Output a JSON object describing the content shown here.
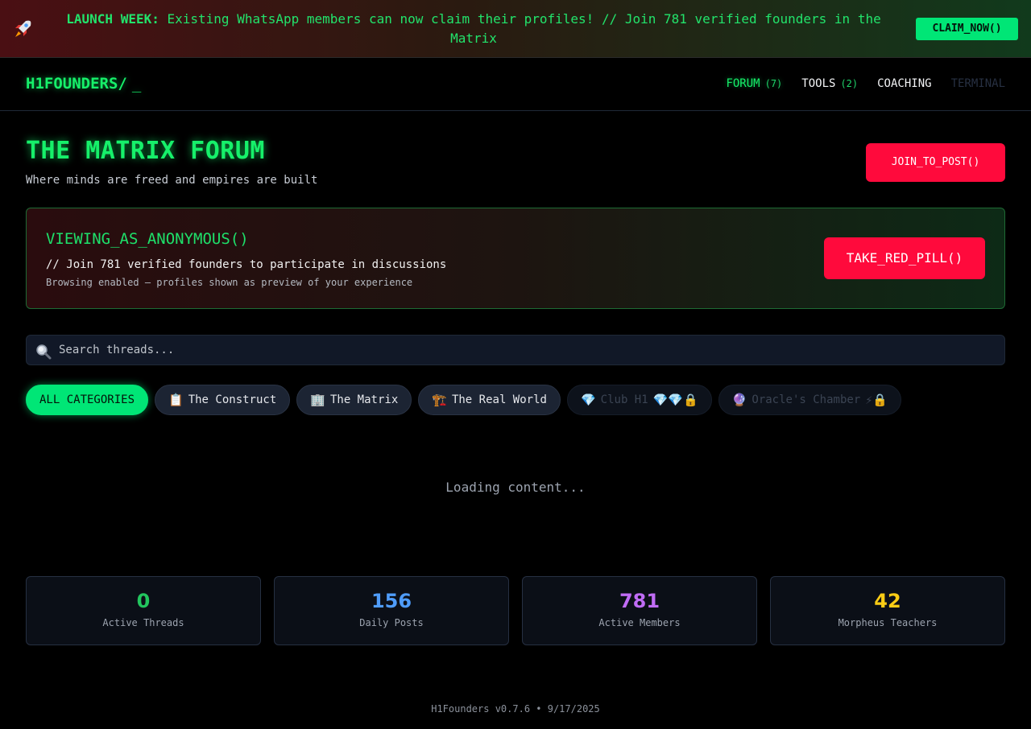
{
  "banner": {
    "icon": "rocket-icon",
    "label": "LAUNCH WEEK:",
    "message": "Existing WhatsApp members can now claim their profiles! // Join 781 verified founders in the Matrix",
    "cta": "CLAIM_NOW()"
  },
  "nav": {
    "logo": "H1FOUNDERS/",
    "cursor": "_",
    "items": [
      {
        "label": "FORUM",
        "count": "(7)",
        "state": "active"
      },
      {
        "label": "TOOLS",
        "count": "(2)",
        "state": "normal"
      },
      {
        "label": "COACHING",
        "count": "",
        "state": "normal"
      },
      {
        "label": "TERMINAL",
        "count": "",
        "state": "disabled"
      }
    ]
  },
  "hero": {
    "title": "THE MATRIX FORUM",
    "subtitle": "Where minds are freed and empires are built",
    "join_button": "JOIN_TO_POST()"
  },
  "anon_panel": {
    "heading": "VIEWING_AS_ANONYMOUS()",
    "line1": "// Join 781 verified founders to participate in discussions",
    "line2": "Browsing enabled — profiles shown as preview of your experience",
    "button": "TAKE_RED_PILL()"
  },
  "search": {
    "icon": "search-icon",
    "placeholder": "Search threads...",
    "value": ""
  },
  "categories": [
    {
      "emoji": "",
      "label": "ALL CATEGORIES",
      "suffix": "",
      "state": "active"
    },
    {
      "emoji": "📋",
      "label": "The Construct",
      "suffix": "",
      "state": "normal"
    },
    {
      "emoji": "🏢",
      "label": "The Matrix",
      "suffix": "",
      "state": "normal"
    },
    {
      "emoji": "🏗️",
      "label": "The Real World",
      "suffix": "",
      "state": "normal"
    },
    {
      "emoji": "💎",
      "label": "Club H1",
      "suffix": "💎💎🔒",
      "state": "locked"
    },
    {
      "emoji": "🔮",
      "label": "Oracle's Chamber",
      "suffix": "⚡🔒",
      "state": "locked"
    }
  ],
  "loading_text": "Loading content...",
  "stats": [
    {
      "value": "0",
      "label": "Active Threads",
      "color": "#22c55e"
    },
    {
      "value": "156",
      "label": "Daily Posts",
      "color": "#4f9cf9"
    },
    {
      "value": "781",
      "label": "Active Members",
      "color": "#c06cf5"
    },
    {
      "value": "42",
      "label": "Morpheus Teachers",
      "color": "#facc15"
    }
  ],
  "footer": "H1Founders v0.7.6 • 9/17/2025",
  "colors": {
    "accent_green": "#16f06a",
    "accent_red": "#ff0a3c",
    "background": "#000000"
  }
}
